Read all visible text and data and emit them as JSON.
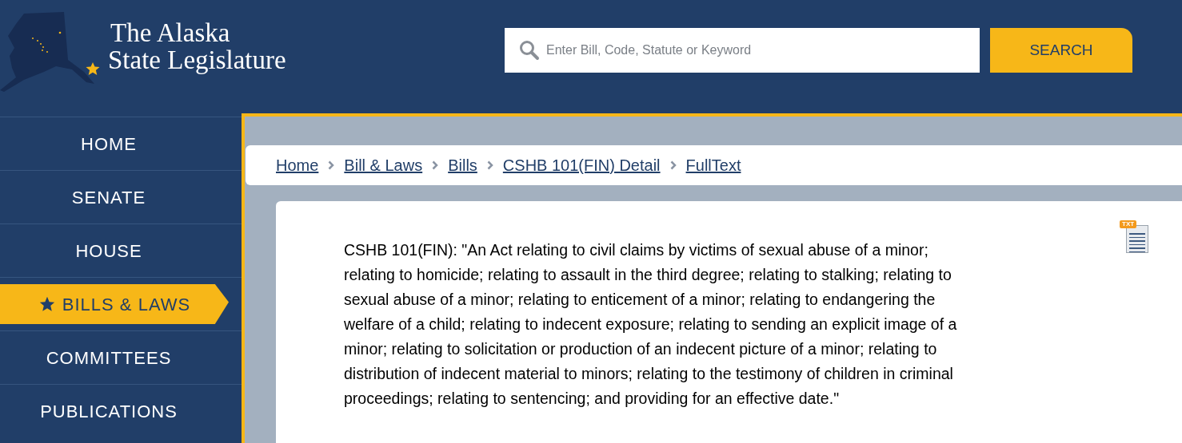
{
  "logo": {
    "line_1": "The Alaska",
    "line_2": "State Legislature"
  },
  "search": {
    "placeholder": "Enter Bill, Code, Statute or Keyword",
    "button": "SEARCH"
  },
  "nav": [
    {
      "label": "HOME",
      "selected": false
    },
    {
      "label": "SENATE",
      "selected": false
    },
    {
      "label": "HOUSE",
      "selected": false
    },
    {
      "label": "BILLS & LAWS",
      "selected": true
    },
    {
      "label": "COMMITTEES",
      "selected": false
    },
    {
      "label": "PUBLICATIONS",
      "selected": false
    }
  ],
  "breadcrumbs": [
    "Home",
    "Bill & Laws",
    "Bills",
    "CSHB 101(FIN) Detail",
    "FullText"
  ],
  "document": {
    "file_icon_label": "TXT",
    "text": "CSHB 101(FIN): \"An Act relating to civil claims by victims of sexual abuse of a minor; relating to homicide; relating to assault in the third degree; relating to stalking; relating to sexual abuse of a minor; relating to enticement of a minor; relating to endangering the welfare of a child; relating to indecent exposure; relating to sending an explicit image of a minor; relating to solicitation or production of an indecent picture of a minor; relating to distribution of indecent material to minors; relating to the testimony of children in criminal proceedings; relating to sentencing; and providing for an effective date.\""
  }
}
